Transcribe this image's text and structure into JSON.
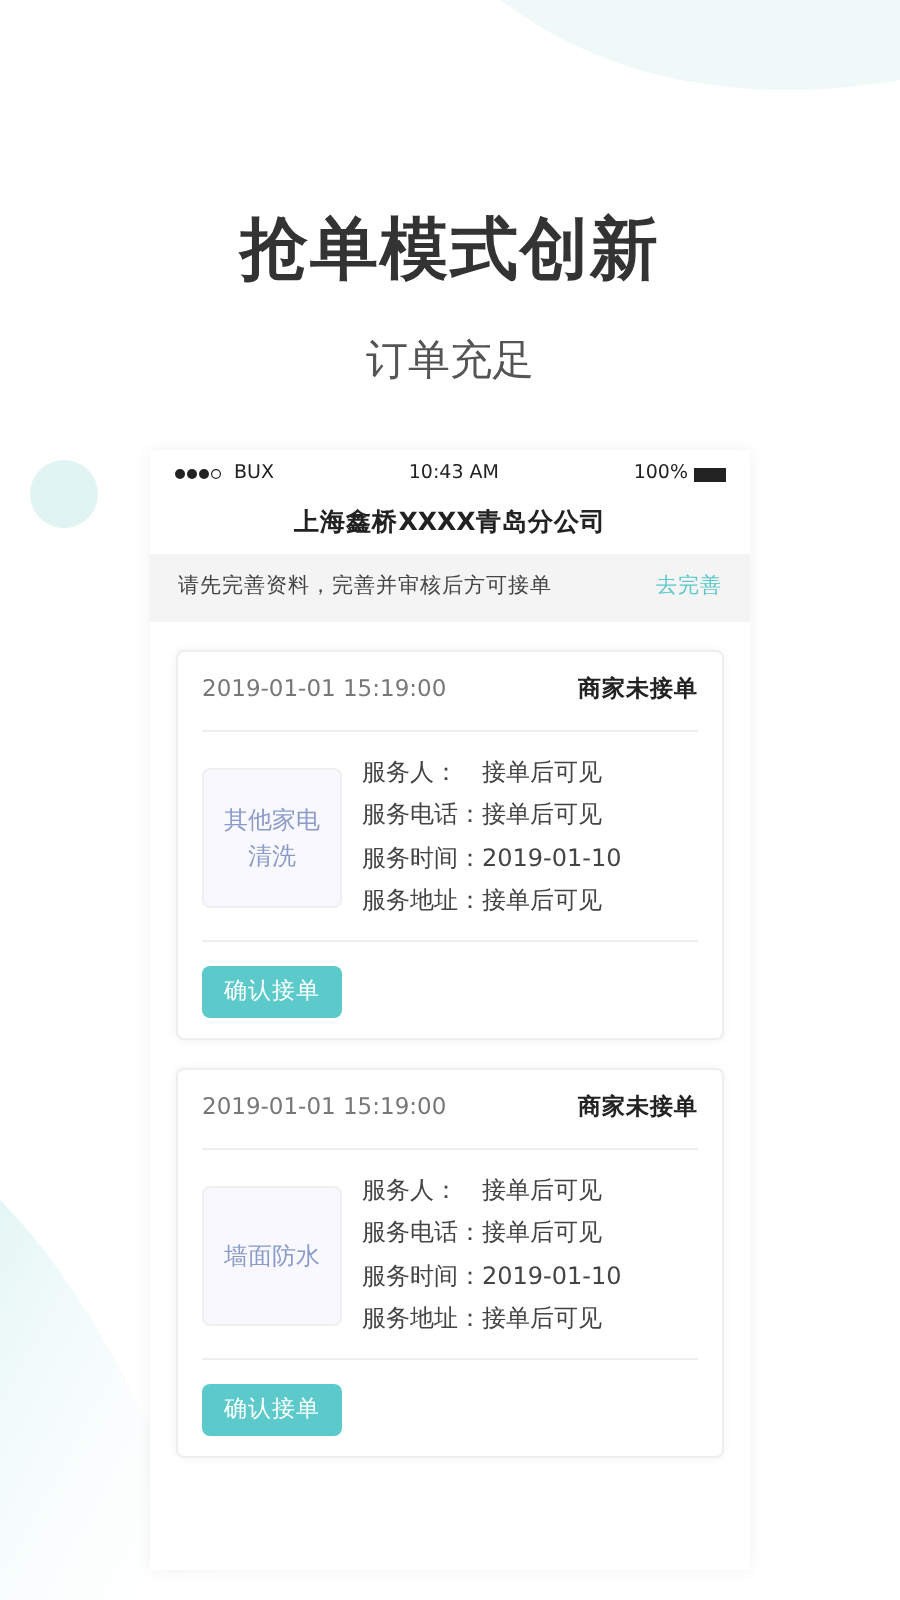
{
  "headline": "抢单模式创新",
  "subheadline": "订单充足",
  "status_bar": {
    "carrier": "BUX",
    "time": "10:43 AM",
    "battery": "100%"
  },
  "title": "上海鑫桥XXXX青岛分公司",
  "notice": {
    "text": "请先完善资料，完善并审核后方可接单",
    "link": "去完善"
  },
  "orders": [
    {
      "time": "2019-01-01 15:19:00",
      "status": "商家未接单",
      "category": "其他家电清洗",
      "fields": [
        {
          "label": "服务人：",
          "value": "接单后可见"
        },
        {
          "label": "服务电话：",
          "value": "接单后可见"
        },
        {
          "label": "服务时间：",
          "value": "2019-01-10"
        },
        {
          "label": "服务地址：",
          "value": "接单后可见"
        }
      ],
      "button": "确认接单"
    },
    {
      "time": "2019-01-01 15:19:00",
      "status": "商家未接单",
      "category": "墙面防水",
      "fields": [
        {
          "label": "服务人：",
          "value": "接单后可见"
        },
        {
          "label": "服务电话：",
          "value": "接单后可见"
        },
        {
          "label": "服务时间：",
          "value": "2019-01-10"
        },
        {
          "label": "服务地址：",
          "value": "接单后可见"
        }
      ],
      "button": "确认接单"
    }
  ]
}
